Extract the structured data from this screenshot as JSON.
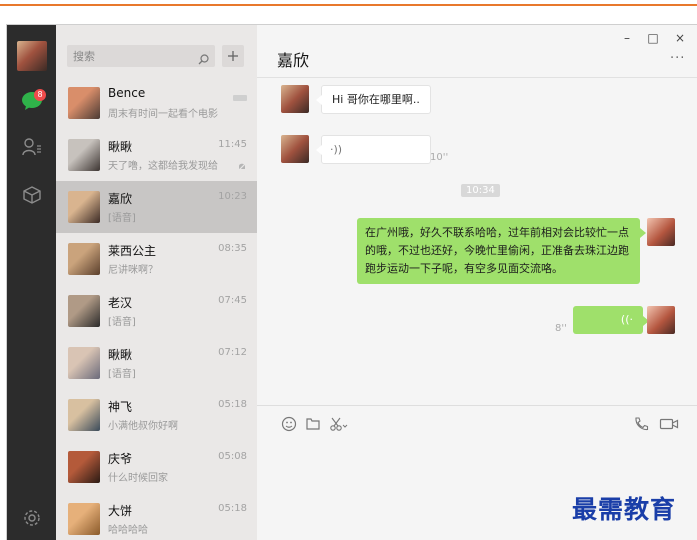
{
  "search": {
    "placeholder": "搜索"
  },
  "sidebar": {
    "badge_count": "8"
  },
  "contacts": [
    {
      "name": "Bence",
      "time": "",
      "preview": "周末有时间一起看个电影",
      "av1": "#d98e6a",
      "av2": "#4a3a34"
    },
    {
      "name": "瞅瞅",
      "time": "11:45",
      "preview": "天了噜，这都给我发现给...",
      "av1": "#c7c2bd",
      "av2": "#3c3431"
    },
    {
      "name": "嘉欣",
      "time": "10:23",
      "preview": "[语音]",
      "av1": "#d9b48f",
      "av2": "#3b2a25"
    },
    {
      "name": "莱西公主",
      "time": "08:35",
      "preview": "尼讲咪啊？",
      "av1": "#caa37c",
      "av2": "#5a3f2c"
    },
    {
      "name": "老汉",
      "time": "07:45",
      "preview": "[语音]",
      "av1": "#b09a86",
      "av2": "#2a2a2a"
    },
    {
      "name": "瞅瞅",
      "time": "07:12",
      "preview": "[语音]",
      "av1": "#d9c4b4",
      "av2": "#6a6a7a"
    },
    {
      "name": "神飞",
      "time": "05:18",
      "preview": "小满他叔你好啊",
      "av1": "#d8c0a0",
      "av2": "#3a4a5a"
    },
    {
      "name": "庆爷",
      "time": "05:08",
      "preview": "什么时候回家",
      "av1": "#b45a3a",
      "av2": "#2a1a14"
    },
    {
      "name": "大饼",
      "time": "05:18",
      "preview": "哈哈哈哈",
      "av1": "#e6b07a",
      "av2": "#8a5a2a"
    }
  ],
  "chat": {
    "title": "嘉欣",
    "more": "···",
    "window_controls": {
      "minimize": "–",
      "maximize": "□",
      "close": "×"
    },
    "messages": {
      "m1_text": "Hi 哥你在哪里啊..",
      "m2_voice_glyph": "·))",
      "m2_duration": "10''",
      "timestamp": "10:34",
      "m3_text": "在广州哦，好久不联系哈哈，过年前相对会比较忙一点的哦，不过也还好，今晚忙里偷闲，正准备去珠江边跑跑步运动一下子呢，有空多见面交流咯。",
      "m4_voice_glyph": "((·",
      "m4_duration": "8''"
    }
  },
  "watermark": "最需教育",
  "colors": {
    "rail": "#2c2c2c",
    "list": "#eae8e7",
    "active": "#c8c6c5",
    "bubble_out": "#9fe06b",
    "accent_line": "#e8782c"
  }
}
